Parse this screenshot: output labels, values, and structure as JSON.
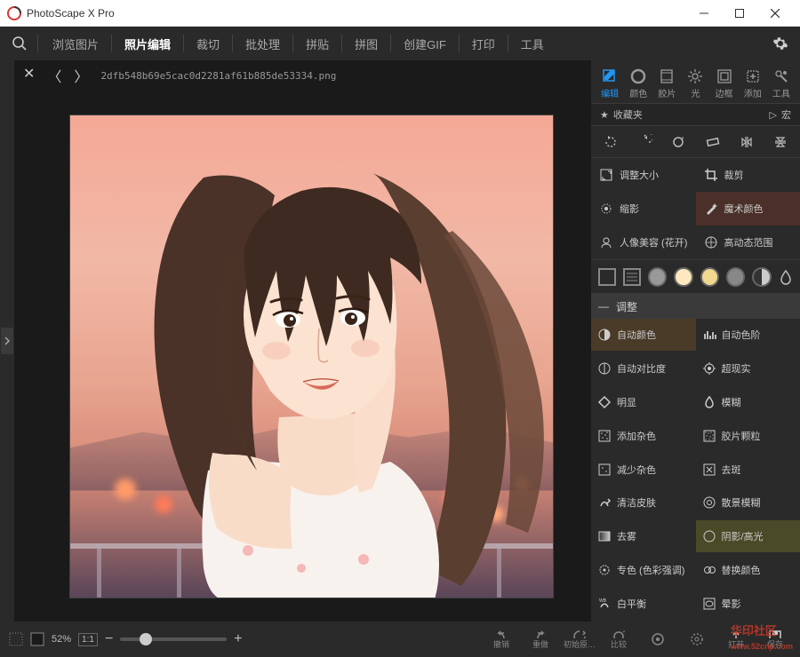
{
  "app": {
    "title": "PhotoScape X Pro"
  },
  "menu": {
    "items": [
      "浏览图片",
      "照片编辑",
      "裁切",
      "批处理",
      "拼贴",
      "拼图",
      "创建GIF",
      "打印",
      "工具"
    ],
    "active_index": 1
  },
  "file": {
    "name": "2dfb548b69e5cac0d2281af61b885de53334.png"
  },
  "tool_tabs": {
    "items": [
      {
        "label": "编辑",
        "icon": "edit"
      },
      {
        "label": "颜色",
        "icon": "color"
      },
      {
        "label": "胶片",
        "icon": "film"
      },
      {
        "label": "光",
        "icon": "light"
      },
      {
        "label": "边框",
        "icon": "frame"
      },
      {
        "label": "添加",
        "icon": "add"
      },
      {
        "label": "工具",
        "icon": "tools"
      }
    ],
    "active_index": 0
  },
  "fav": {
    "favorites": "收藏夹",
    "macro": "宏"
  },
  "tool_grid": [
    {
      "label": "调整大小",
      "icon": "resize"
    },
    {
      "label": "裁剪",
      "icon": "crop"
    },
    {
      "label": "缩影",
      "icon": "mini"
    },
    {
      "label": "魔术颜色",
      "icon": "magic",
      "highlight": true
    },
    {
      "label": "人像美容 (花开)",
      "icon": "portrait"
    },
    {
      "label": "高动态范围",
      "icon": "hdr"
    }
  ],
  "swatches": [
    "#ffffff",
    "#999999",
    "#ffe8c0",
    "#f0d890",
    "#888888",
    "#333333"
  ],
  "section": {
    "adjust": "调整"
  },
  "adjust": [
    {
      "label": "自动颜色",
      "icon": "autocolor",
      "sel": 1
    },
    {
      "label": "自动色阶",
      "icon": "autolevel"
    },
    {
      "label": "自动对比度",
      "icon": "autocontrast"
    },
    {
      "label": "超现实",
      "icon": "surreal"
    },
    {
      "label": "明显",
      "icon": "clarity"
    },
    {
      "label": "模糊",
      "icon": "blur"
    },
    {
      "label": "添加杂色",
      "icon": "addnoise"
    },
    {
      "label": "胶片颗粒",
      "icon": "grain"
    },
    {
      "label": "减少杂色",
      "icon": "denoise"
    },
    {
      "label": "去斑",
      "icon": "despeckle"
    },
    {
      "label": "清洁皮肤",
      "icon": "skin"
    },
    {
      "label": "散景模糊",
      "icon": "bokeh"
    },
    {
      "label": "去雾",
      "icon": "dehaze"
    },
    {
      "label": "阴影/高光",
      "icon": "shadow",
      "sel": 2
    },
    {
      "label": "专色 (色彩强调)",
      "icon": "spot"
    },
    {
      "label": "替换颜色",
      "icon": "replace"
    },
    {
      "label": "白平衡",
      "icon": "wb"
    },
    {
      "label": "晕影",
      "icon": "vignette"
    }
  ],
  "bottom": {
    "zoom": "52%",
    "onetoone": "1:1",
    "actions": [
      {
        "label": "撤销",
        "icon": "undo"
      },
      {
        "label": "重做",
        "icon": "redo"
      },
      {
        "label": "初始原…",
        "icon": "reset"
      },
      {
        "label": "比较",
        "icon": "compare"
      },
      {
        "label": "",
        "icon": "history1"
      },
      {
        "label": "",
        "icon": "history2"
      },
      {
        "label": "打开",
        "icon": "open"
      },
      {
        "label": "保存",
        "icon": "save"
      }
    ]
  },
  "watermark": {
    "text": "华印社区",
    "url": "www.52cnp.com"
  }
}
